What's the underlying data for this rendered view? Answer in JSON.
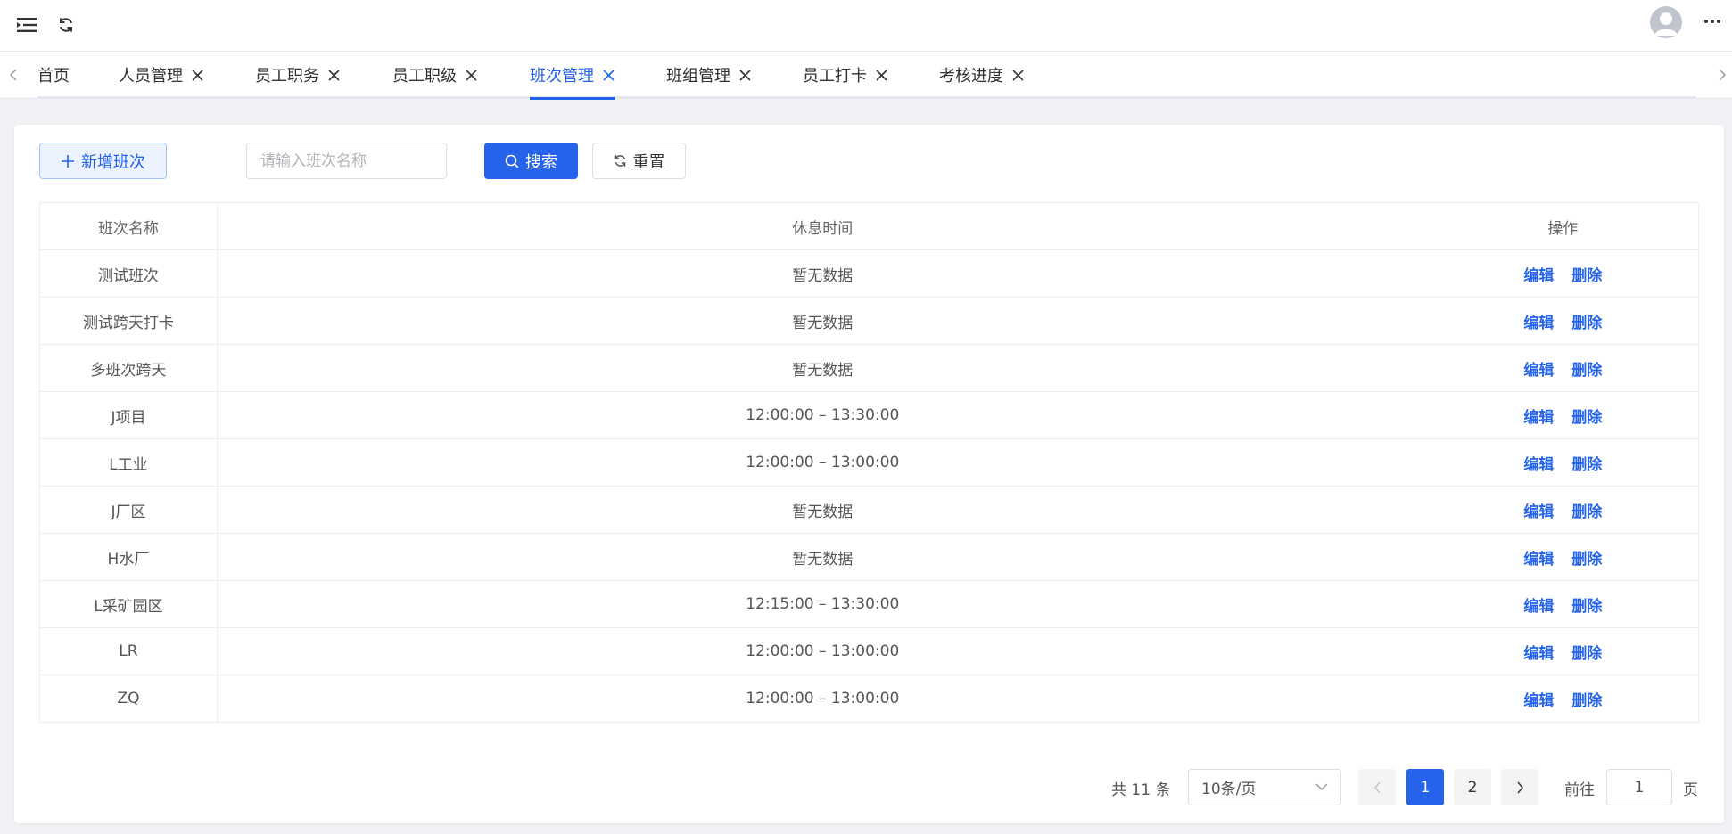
{
  "tabs": [
    {
      "label": "首页",
      "closable": false
    },
    {
      "label": "人员管理",
      "closable": true
    },
    {
      "label": "员工职务",
      "closable": true
    },
    {
      "label": "员工职级",
      "closable": true
    },
    {
      "label": "班次管理",
      "closable": true,
      "active": true
    },
    {
      "label": "班组管理",
      "closable": true
    },
    {
      "label": "员工打卡",
      "closable": true
    },
    {
      "label": "考核进度",
      "closable": true
    }
  ],
  "toolbar": {
    "add_label": "新增班次",
    "search_placeholder": "请输入班次名称",
    "search_value": "",
    "search_label": "搜索",
    "reset_label": "重置"
  },
  "table": {
    "columns": [
      "班次名称",
      "休息时间",
      "操作"
    ],
    "edit_label": "编辑",
    "delete_label": "删除",
    "rows": [
      {
        "name": "测试班次",
        "rest": "暂无数据"
      },
      {
        "name": "测试跨天打卡",
        "rest": "暂无数据"
      },
      {
        "name": "多班次跨天",
        "rest": "暂无数据"
      },
      {
        "name": "J项目",
        "rest": "12:00:00 – 13:30:00"
      },
      {
        "name": "L工业",
        "rest": "12:00:00 – 13:00:00"
      },
      {
        "name": "J厂区",
        "rest": "暂无数据"
      },
      {
        "name": "H水厂",
        "rest": "暂无数据"
      },
      {
        "name": "L采矿园区",
        "rest": "12:15:00 – 13:30:00"
      },
      {
        "name": "LR",
        "rest": "12:00:00 – 13:00:00"
      },
      {
        "name": "ZQ",
        "rest": "12:00:00 – 13:00:00"
      }
    ]
  },
  "pagination": {
    "total_text": "共 11 条",
    "page_size": "10条/页",
    "pages": [
      "1",
      "2"
    ],
    "current": "1",
    "goto_label": "前往",
    "goto_value": "1",
    "page_unit": "页"
  },
  "colors": {
    "primary": "#2563eb"
  }
}
